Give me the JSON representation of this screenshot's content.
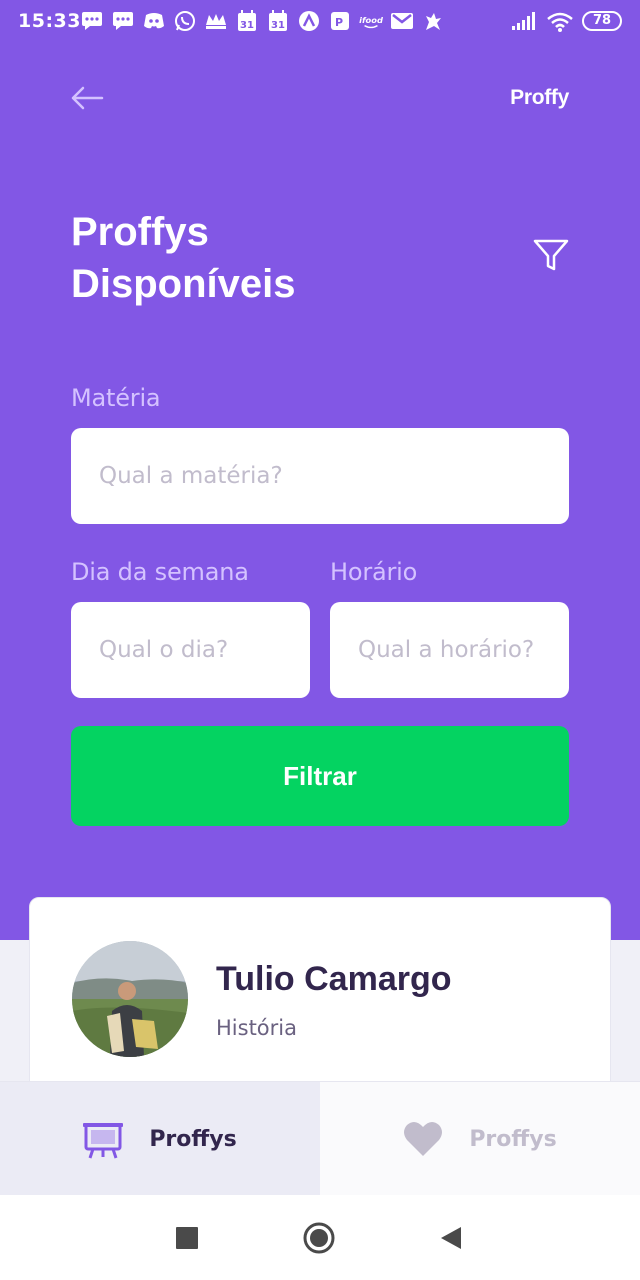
{
  "status_bar": {
    "time": "15:33",
    "battery": "78",
    "notification_icons": [
      "message-icon",
      "message-icon",
      "discord-icon",
      "whatsapp-icon",
      "crown-icon",
      "calendar-icon",
      "calendar-icon",
      "arrow-icon",
      "pf-icon",
      "ifood-icon",
      "gmail-icon",
      "squirrel-icon"
    ],
    "calendar_day": "31",
    "ifood_label": "ifood"
  },
  "header": {
    "logo": "Proffy",
    "title": "Proffys Disponíveis"
  },
  "form": {
    "subject_label": "Matéria",
    "subject_placeholder": "Qual a matéria?",
    "weekday_label": "Dia da semana",
    "weekday_placeholder": "Qual o dia?",
    "time_label": "Horário",
    "time_placeholder": "Qual a horário?",
    "submit_label": "Filtrar"
  },
  "teacher_card": {
    "name": "Tulio Camargo",
    "subject": "História"
  },
  "tabs": [
    {
      "label": "Proffys",
      "icon": "easel-icon",
      "active": true
    },
    {
      "label": "Proffys",
      "icon": "heart-icon",
      "active": false
    }
  ],
  "colors": {
    "primary": "#8257E5",
    "secondary": "#04D361",
    "label": "#D4C2FF",
    "title_dark": "#32264D",
    "background": "#F0F0F7"
  }
}
